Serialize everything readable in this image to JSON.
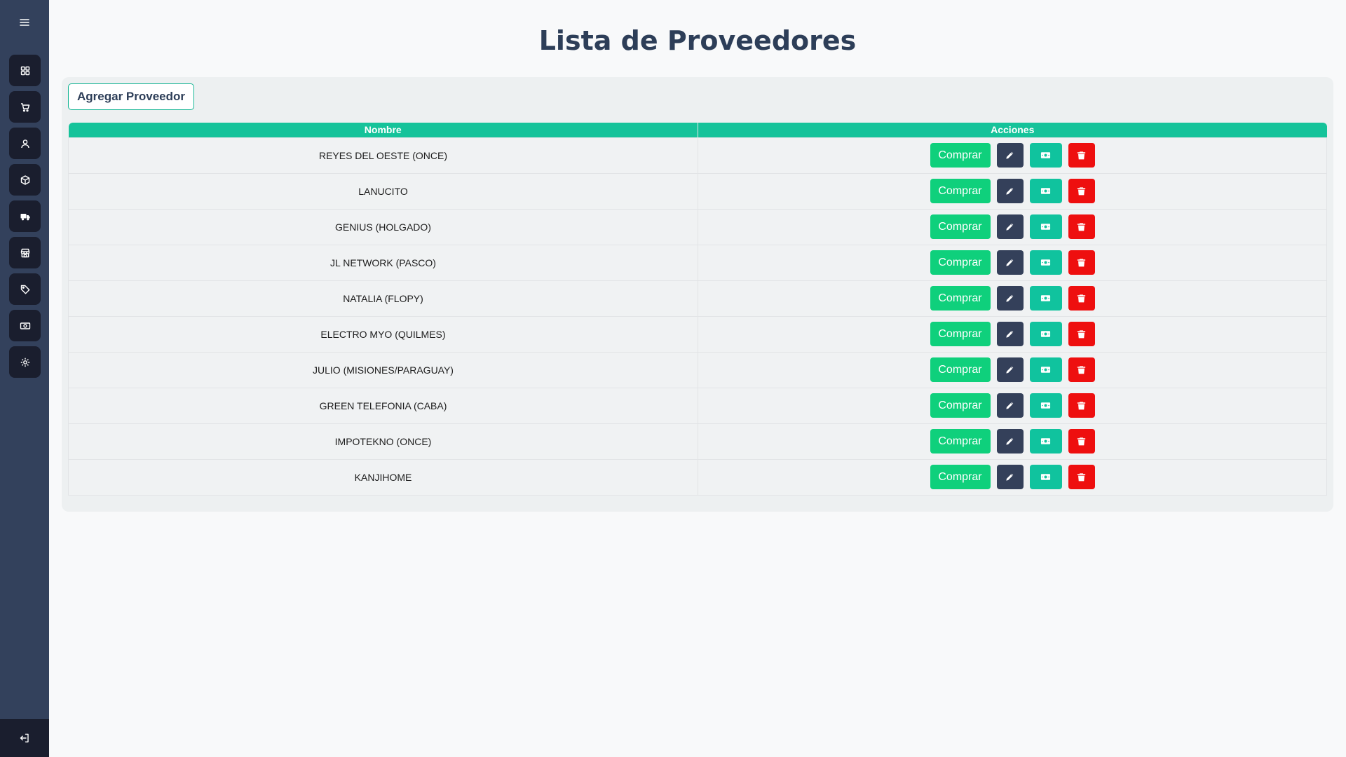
{
  "page": {
    "title": "Lista de Proveedores"
  },
  "toolbar": {
    "add_label": "Agregar Proveedor"
  },
  "sidebar": {
    "items": [
      {
        "icon": "dashboard-icon"
      },
      {
        "icon": "cart-icon"
      },
      {
        "icon": "user-icon"
      },
      {
        "icon": "box-icon"
      },
      {
        "icon": "truck-icon"
      },
      {
        "icon": "store-icon"
      },
      {
        "icon": "tag-icon"
      },
      {
        "icon": "cash-icon"
      },
      {
        "icon": "gear-icon"
      }
    ],
    "logout_icon": "logout-icon"
  },
  "table": {
    "headers": {
      "name": "Nombre",
      "actions": "Acciones"
    },
    "buy_label": "Comprar",
    "rows": [
      "REYES DEL OESTE (ONCE)",
      "LANUCITO",
      "GENIUS (HOLGADO)",
      "JL NETWORK (PASCO)",
      "NATALIA (FLOPY)",
      "ELECTRO MYO (QUILMES)",
      "JULIO (MISIONES/PARAGUAY)",
      "GREEN TELEFONIA (CABA)",
      "IMPOTEKNO (ONCE)",
      "KANJIHOME"
    ]
  },
  "colors": {
    "sidebar_bg": "#33415c",
    "sidebar_button": "#1a1e2e",
    "header_green": "#15c39a",
    "buy_green": "#0fd07c",
    "edit_dark": "#34405a",
    "pay_teal": "#10c39e",
    "delete_red": "#ee0f0f"
  }
}
